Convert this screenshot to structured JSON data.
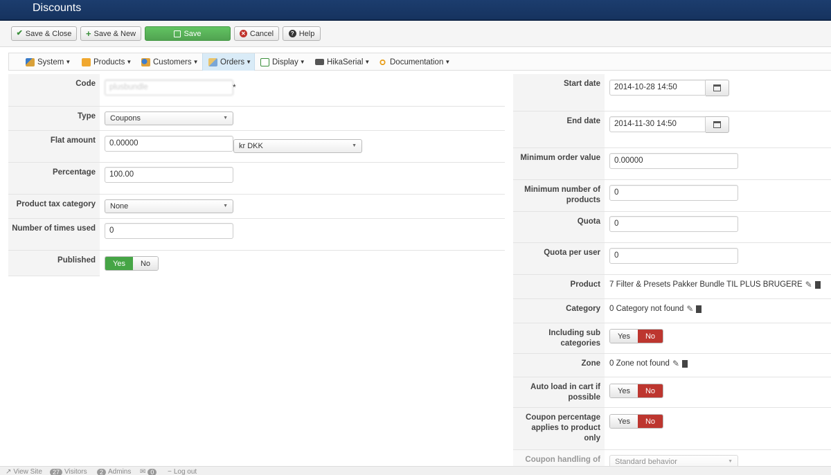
{
  "header": {
    "title": "Discounts"
  },
  "toolbar": {
    "save_close": "Save & Close",
    "save_new": "Save & New",
    "save": "Save",
    "cancel": "Cancel",
    "help": "Help"
  },
  "menu": {
    "items": [
      {
        "label": "System",
        "icon": "tools-icon"
      },
      {
        "label": "Products",
        "icon": "box-icon"
      },
      {
        "label": "Customers",
        "icon": "users-icon"
      },
      {
        "label": "Orders",
        "icon": "cart-icon"
      },
      {
        "label": "Display",
        "icon": "display-icon"
      },
      {
        "label": "HikaSerial",
        "icon": "serial-icon"
      },
      {
        "label": "Documentation",
        "icon": "docs-icon"
      }
    ],
    "active": "Orders"
  },
  "left": {
    "code": {
      "label": "Code",
      "value": "plusbundle",
      "required_mark": "*"
    },
    "type": {
      "label": "Type",
      "selected": "Coupons"
    },
    "flat_amount": {
      "label": "Flat amount",
      "value": "0.00000",
      "currency": "kr DKK"
    },
    "percentage": {
      "label": "Percentage",
      "value": "100.00"
    },
    "tax_category": {
      "label": "Product tax category",
      "selected": "None"
    },
    "times_used": {
      "label": "Number of times used",
      "value": "0"
    },
    "published": {
      "label": "Published",
      "yes": "Yes",
      "no": "No",
      "state": "yes"
    }
  },
  "right": {
    "start_date": {
      "label": "Start date",
      "value": "2014-10-28 14:50"
    },
    "end_date": {
      "label": "End date",
      "value": "2014-11-30 14:50"
    },
    "min_order": {
      "label": "Minimum order value",
      "value": "0.00000"
    },
    "min_products": {
      "label": "Minimum number of products",
      "value": "0"
    },
    "quota": {
      "label": "Quota",
      "value": "0"
    },
    "quota_user": {
      "label": "Quota per user",
      "value": "0"
    },
    "product": {
      "label": "Product",
      "value": "7 Filter & Presets Pakker Bundle TIL PLUS BRUGERE"
    },
    "category": {
      "label": "Category",
      "value": "0 Category not found"
    },
    "sub_categories": {
      "label": "Including sub categories",
      "yes": "Yes",
      "no": "No",
      "state": "no"
    },
    "zone": {
      "label": "Zone",
      "value": "0 Zone not found"
    },
    "auto_load": {
      "label": "Auto load in cart if possible",
      "yes": "Yes",
      "no": "No",
      "state": "no"
    },
    "pct_product": {
      "label": "Coupon percentage applies to product only",
      "yes": "Yes",
      "no": "No",
      "state": "no"
    },
    "handling": {
      "label": "Coupon handling of",
      "selected": "Standard behavior"
    }
  },
  "status": {
    "view_site": "View Site",
    "visitors_count": "27",
    "visitors": "Visitors",
    "admins_count": "2",
    "admins": "Admins",
    "messages_count": "0",
    "logout": "Log out"
  },
  "colors": {
    "header": "#1c3d6e",
    "save_green": "#51a351",
    "yes_active": "#46a546",
    "no_active": "#bd362f",
    "menu_active": "#d9ebf7"
  }
}
